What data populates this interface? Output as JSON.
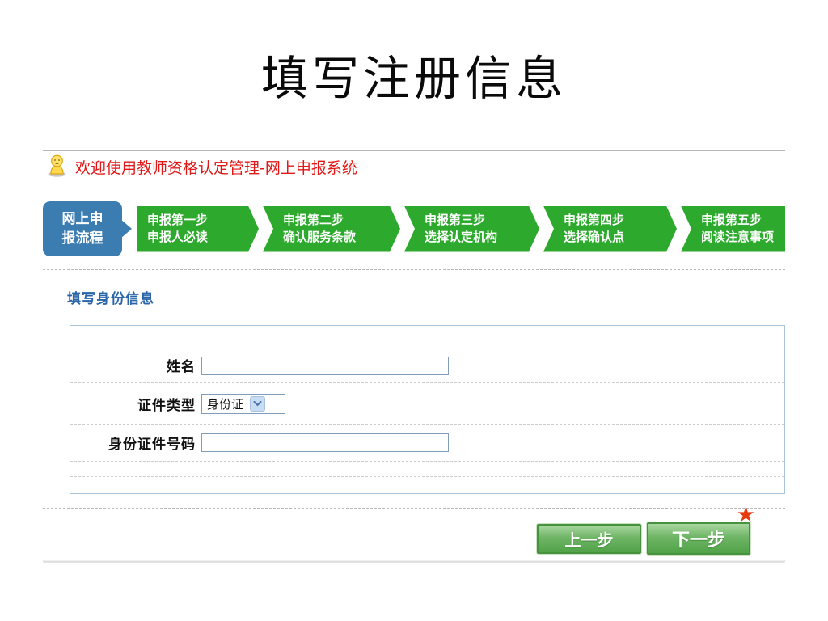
{
  "title": "填写注册信息",
  "welcome": {
    "icon": "person-icon",
    "text": "欢迎使用教师资格认定管理-网上申报系统"
  },
  "steps": {
    "intro_line1": "网上申",
    "intro_line2": "报流程",
    "items": [
      {
        "line1": "申报第一步",
        "line2": "申报人必读"
      },
      {
        "line1": "申报第二步",
        "line2": "确认服务条款"
      },
      {
        "line1": "申报第三步",
        "line2": "选择认定机构"
      },
      {
        "line1": "申报第四步",
        "line2": "选择确认点"
      },
      {
        "line1": "申报第五步",
        "line2": "阅读注意事项"
      }
    ]
  },
  "section": {
    "heading": "填写身份信息"
  },
  "form": {
    "name_label": "姓名",
    "name_value": "",
    "id_type_label": "证件类型",
    "id_type_value": "身份证",
    "id_number_label": "身份证件号码",
    "id_number_value": ""
  },
  "actions": {
    "prev": "上一步",
    "next": "下一步",
    "required_star": "★"
  },
  "colors": {
    "step_green": "#2daa2d",
    "intro_blue": "#3b7cb1",
    "welcome_red": "#e01818",
    "heading_blue": "#2a65a8",
    "button_green": "#51a348",
    "star_red": "#e8380d"
  }
}
